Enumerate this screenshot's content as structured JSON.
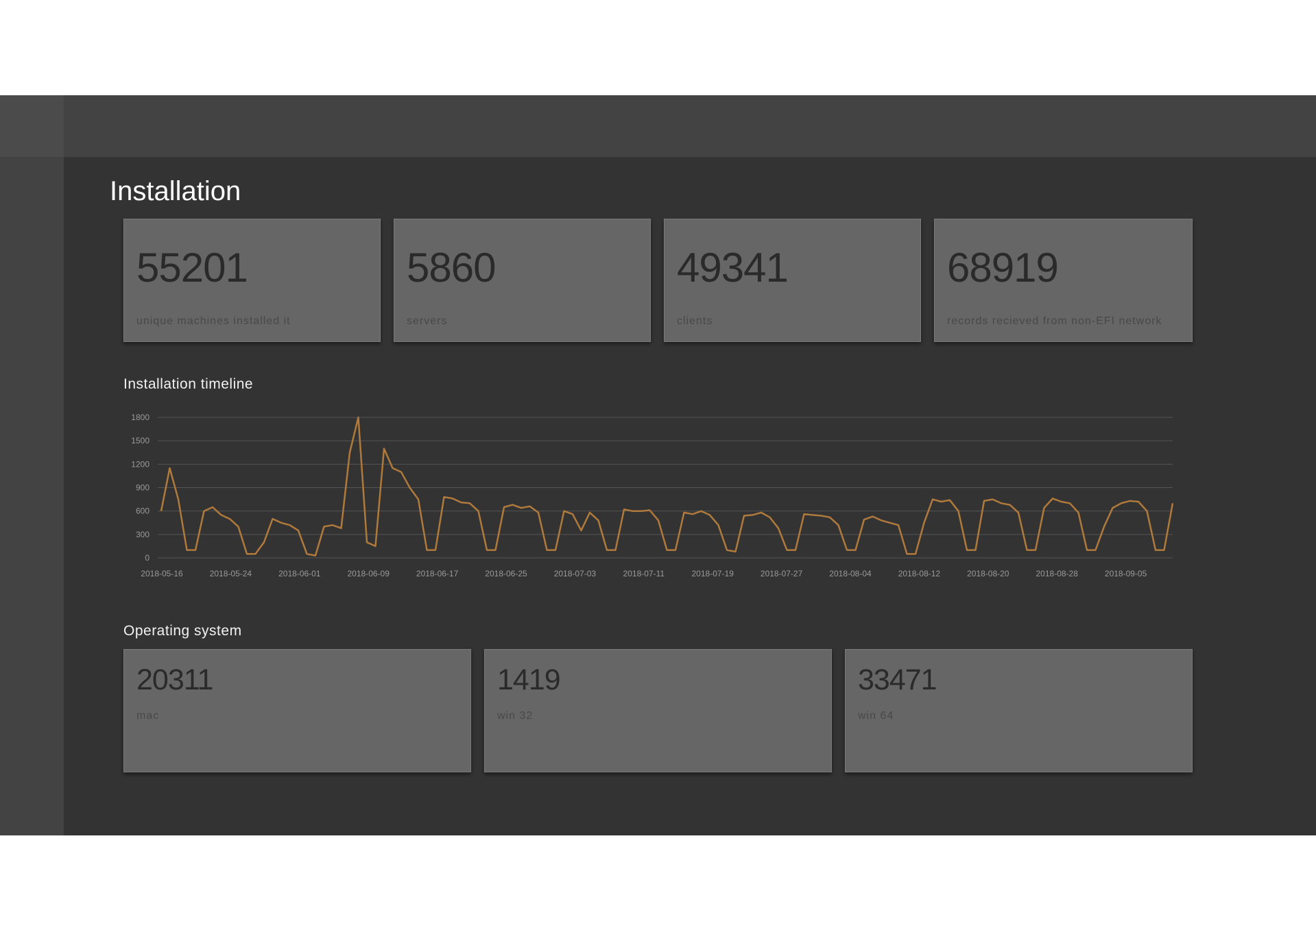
{
  "page": {
    "title": "Installation"
  },
  "stats": [
    {
      "value": "55201",
      "label": "unique machines installed it"
    },
    {
      "value": "5860",
      "label": "servers"
    },
    {
      "value": "49341",
      "label": "clients"
    },
    {
      "value": "68919",
      "label": "records recieved from non-EFI network"
    }
  ],
  "timeline": {
    "title": "Installation timeline"
  },
  "os": {
    "title": "Operating system",
    "items": [
      {
        "value": "20311",
        "label": "mac"
      },
      {
        "value": "1419",
        "label": "win 32"
      },
      {
        "value": "33471",
        "label": "win 64"
      }
    ]
  },
  "colors": {
    "line": "#b07a3c",
    "grid": "#555555",
    "tick": "#9a9a9a"
  },
  "chart_data": {
    "type": "line",
    "title": "Installation timeline",
    "xlabel": "",
    "ylabel": "",
    "ylim": [
      0,
      1800
    ],
    "yticks": [
      0,
      300,
      600,
      900,
      1200,
      1500,
      1800
    ],
    "xtick_labels": [
      "2018-05-16",
      "2018-05-24",
      "2018-06-01",
      "2018-06-09",
      "2018-06-17",
      "2018-06-25",
      "2018-07-03",
      "2018-07-11",
      "2018-07-19",
      "2018-07-27",
      "2018-08-04",
      "2018-08-12",
      "2018-08-20",
      "2018-08-28",
      "2018-09-05"
    ],
    "grid": true,
    "series": [
      {
        "values": [
          600,
          1150,
          750,
          100,
          100,
          600,
          650,
          550,
          500,
          400,
          50,
          50,
          200,
          500,
          450,
          420,
          350,
          50,
          30,
          400,
          420,
          380,
          1350,
          1800,
          200,
          150,
          1400,
          1150,
          1100,
          900,
          750,
          100,
          100,
          780,
          760,
          710,
          700,
          600,
          100,
          100,
          650,
          680,
          640,
          660,
          580,
          100,
          100,
          600,
          560,
          350,
          580,
          480,
          100,
          100,
          620,
          600,
          600,
          610,
          480,
          100,
          100,
          580,
          560,
          600,
          550,
          420,
          100,
          80,
          540,
          550,
          580,
          520,
          380,
          100,
          100,
          560,
          550,
          540,
          520,
          420,
          100,
          100,
          490,
          530,
          480,
          450,
          420,
          50,
          50,
          450,
          750,
          720,
          740,
          600,
          100,
          100,
          730,
          750,
          700,
          680,
          580,
          100,
          100,
          640,
          760,
          720,
          700,
          580,
          100,
          100,
          400,
          640,
          700,
          730,
          720,
          600,
          100,
          100,
          700
        ]
      }
    ]
  }
}
